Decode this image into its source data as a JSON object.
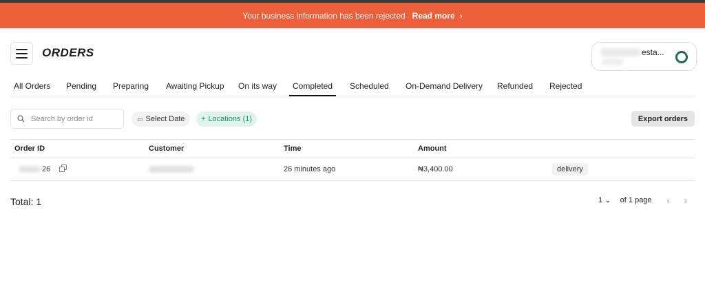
{
  "banner": {
    "message": "Your business information has been rejected",
    "link_label": "Read more",
    "color": "#ec5f3a"
  },
  "header": {
    "title": "ORDERS",
    "account_name": "esta..."
  },
  "tabs": [
    "All Orders",
    "Pending",
    "Preparing",
    "Awaiting Pickup",
    "On its way",
    "Completed",
    "Scheduled",
    "On-Demand Delivery",
    "Refunded",
    "Rejected"
  ],
  "active_tab": "Completed",
  "filters": {
    "search_placeholder": "Search by order id",
    "date_label": "Select Date",
    "location_label": "Locations (1)",
    "export_label": "Export orders"
  },
  "table": {
    "columns": [
      "Order ID",
      "Customer",
      "Time",
      "Amount"
    ],
    "rows": [
      {
        "order_id_suffix": "26",
        "time": "26 minutes ago",
        "amount": "₦3,400.00",
        "type": "delivery"
      }
    ]
  },
  "footer": {
    "total": "Total: 1",
    "page_select": "1",
    "page_info": "of 1 page"
  },
  "colors": {
    "accent_green": "#1a9467",
    "chip_green_bg": "#e0f4ec"
  }
}
